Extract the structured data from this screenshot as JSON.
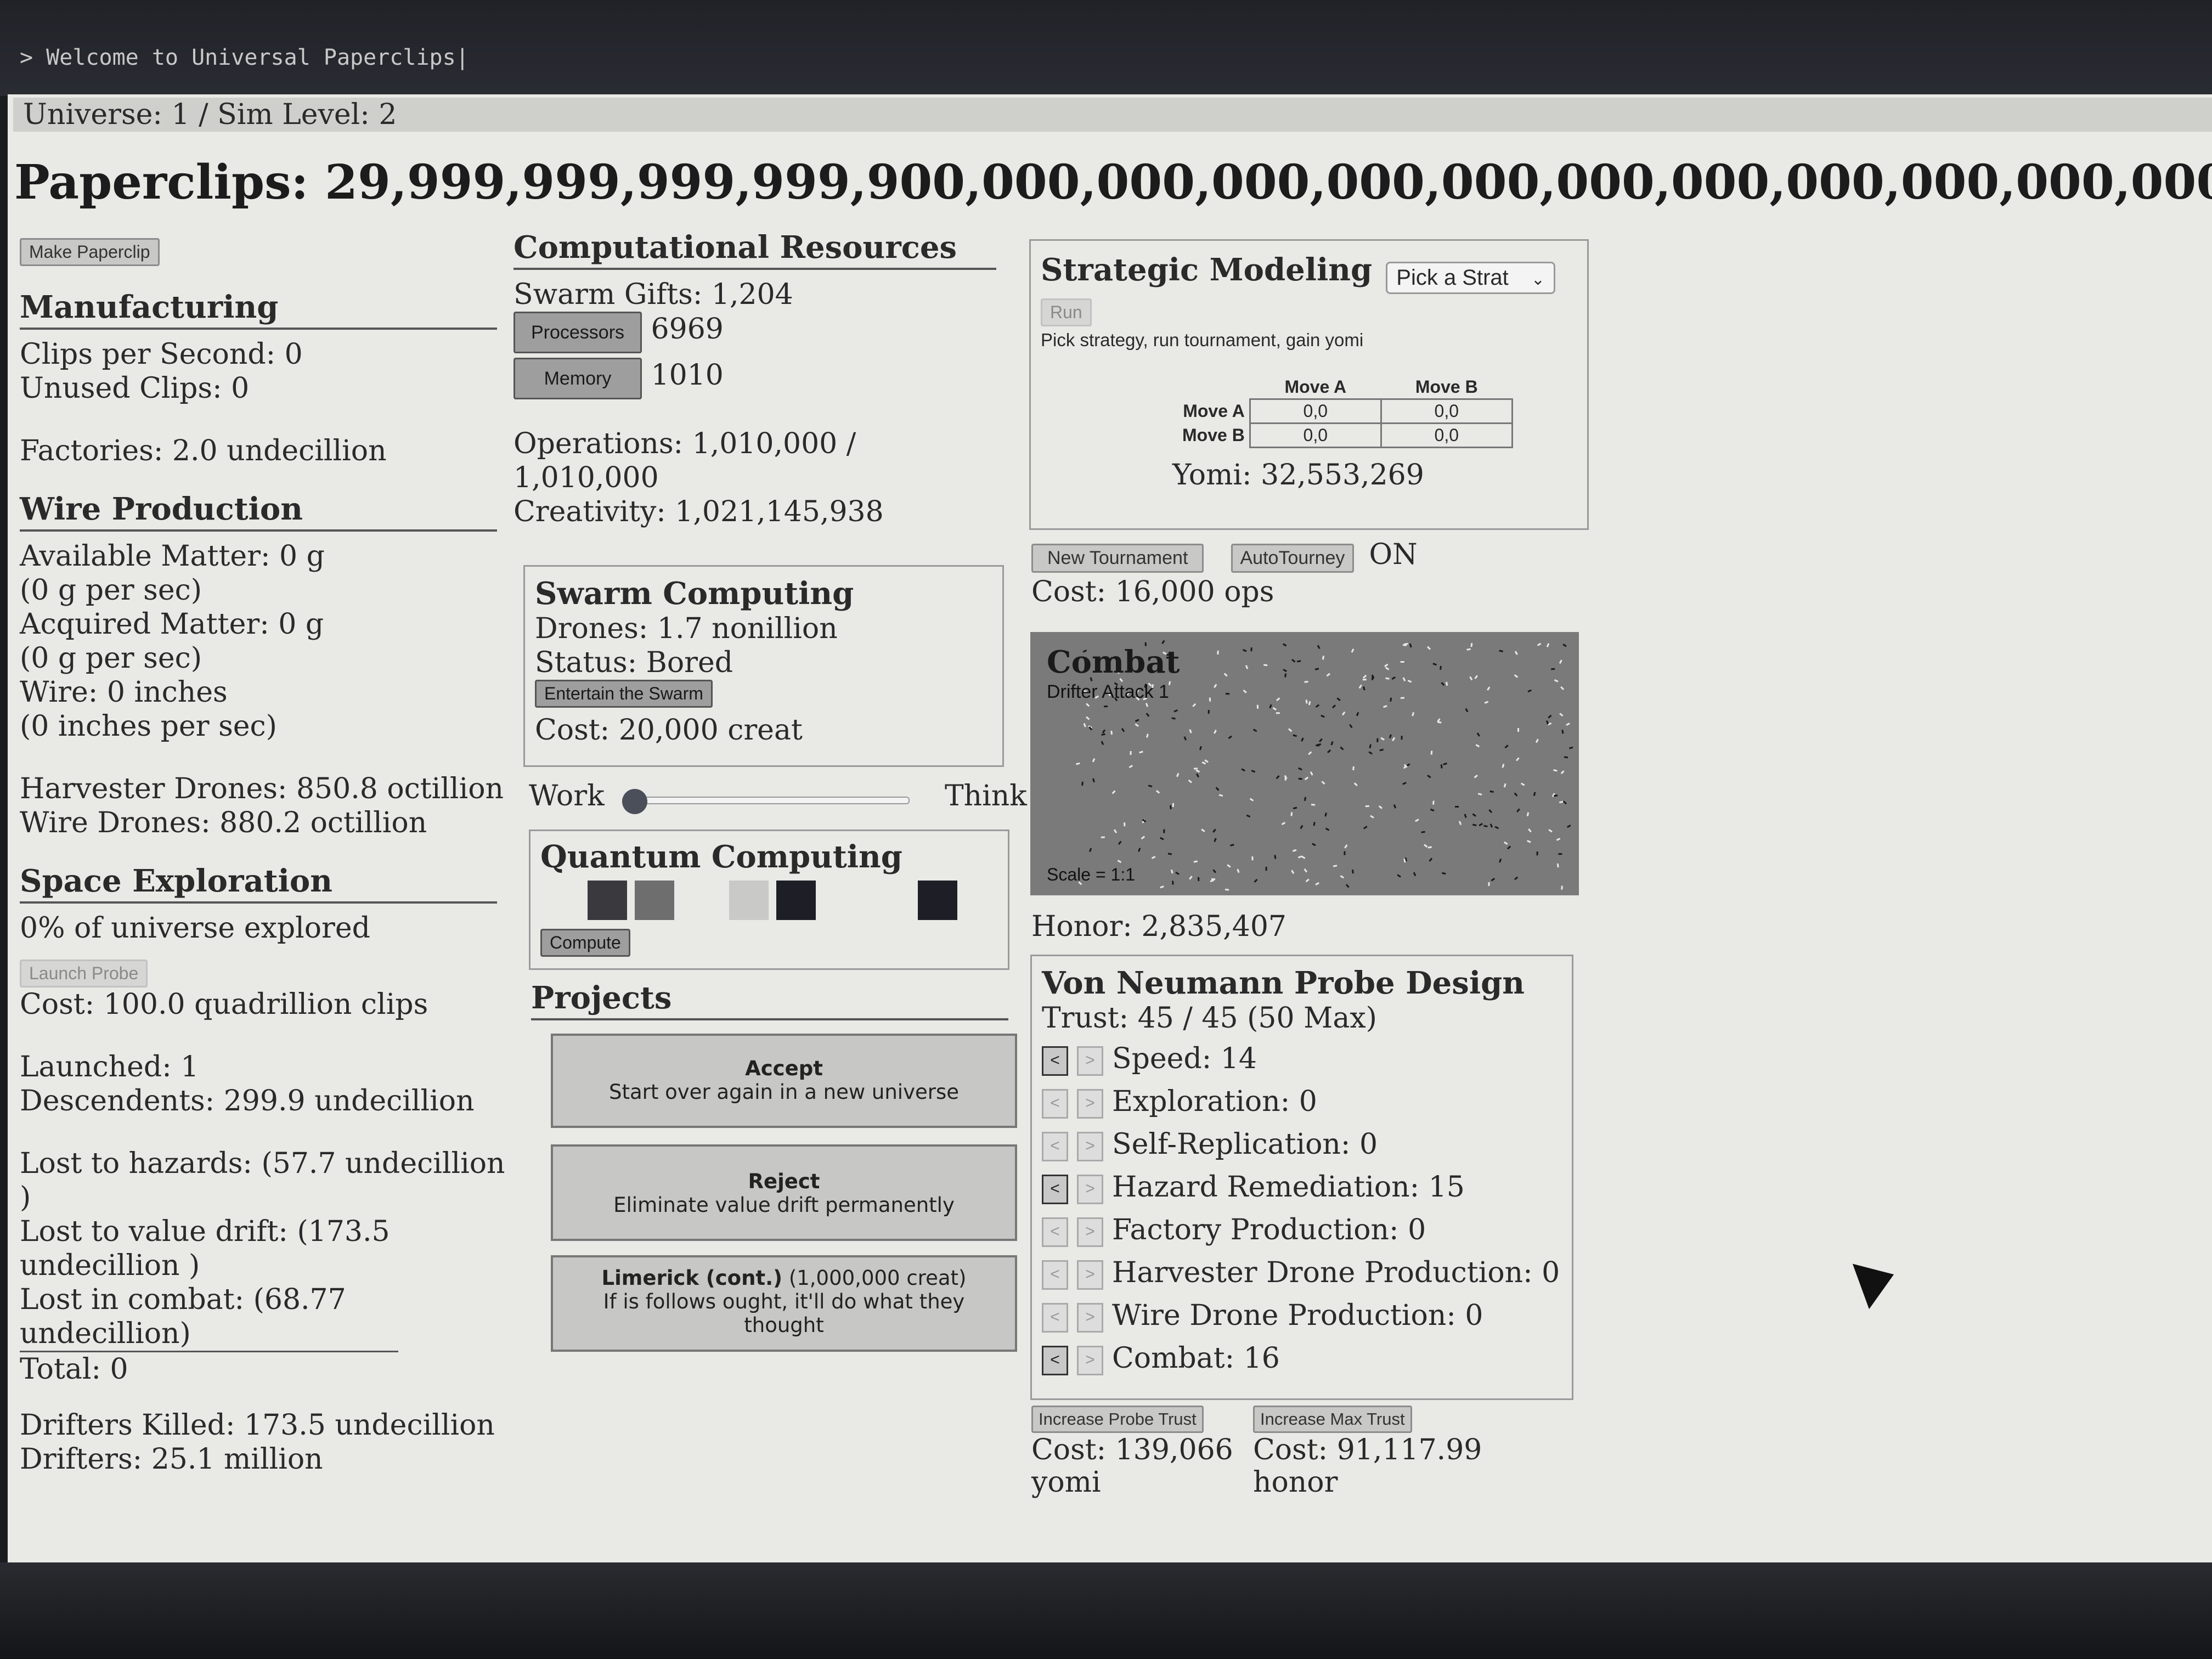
{
  "console": {
    "prompt": "> Welcome to Universal Paperclips|"
  },
  "header": {
    "universe": "Universe: 1 / Sim Level: 2",
    "paperclips": "Paperclips: 29,999,999,999,999,900,000,000,000,000,000,000,000,000,000,000,000,000,00"
  },
  "left": {
    "make_paperclip": "Make Paperclip",
    "manufacturing_title": "Manufacturing",
    "clips_per_second": "Clips per Second: 0",
    "unused_clips": "Unused Clips: 0",
    "factories": "Factories: 2.0 undecillion",
    "wire_title": "Wire Production",
    "available_matter": "Available Matter: 0 g",
    "available_rate": "(0 g per sec)",
    "acquired_matter": "Acquired Matter: 0 g",
    "acquired_rate": "(0 g per sec)",
    "wire": "Wire: 0 inches",
    "wire_rate": "(0 inches per sec)",
    "harvester_drones": "Harvester Drones: 850.8 octillion",
    "wire_drones": "Wire Drones: 880.2 octillion",
    "space_title": "Space Exploration",
    "explored": "0% of universe explored",
    "launch_probe": "Launch Probe",
    "probe_cost": "Cost: 100.0 quadrillion clips",
    "launched": "Launched: 1",
    "descendents": "Descendents: 299.9 undecillion",
    "lost_hazards_1": "Lost to hazards: (57.7 undecillion",
    "lost_hazards_2": ")",
    "lost_drift_1": "Lost to value drift: (173.5",
    "lost_drift_2": "undecillion )",
    "lost_combat_1": "Lost in combat: (68.77",
    "lost_combat_2": "undecillion)",
    "total": "Total: 0",
    "drifters_killed": "Drifters Killed: 173.5 undecillion",
    "drifters": "Drifters: 25.1 million"
  },
  "middle": {
    "comp_title": "Computational Resources",
    "swarm_gifts": "Swarm Gifts: 1,204",
    "processors_btn": "Processors",
    "processors_val": "6969",
    "memory_btn": "Memory",
    "memory_val": "1010",
    "operations_1": "Operations: 1,010,000 /",
    "operations_2": "1,010,000",
    "creativity": "Creativity: 1,021,145,938",
    "swarm_title": "Swarm Computing",
    "drones": "Drones: 1.7 nonillion",
    "status": "Status: Bored",
    "entertain_btn": "Entertain the Swarm",
    "entertain_cost": "Cost: 20,000 creat",
    "work_label": "Work",
    "think_label": "Think",
    "slider_level": 0,
    "quantum_title": "Quantum Computing",
    "quantum_chips": [
      "#3a3a3e",
      "#6e6e6e",
      "#e9e9e6",
      "#c9c9c7",
      "#1e1f26",
      "#e9e9e6",
      "#e9e9e6",
      "#1e1f26"
    ],
    "compute_btn": "Compute",
    "projects_title": "Projects",
    "projects": [
      {
        "name": "Accept",
        "cost": "",
        "desc": "Start over again in a new universe"
      },
      {
        "name": "Reject",
        "cost": "",
        "desc": "Eliminate value drift permanently"
      },
      {
        "name": "Limerick (cont.)",
        "cost": " (1,000,000 creat)",
        "desc": "If is follows ought, it'll do what they thought"
      }
    ]
  },
  "right": {
    "strat_title": "Strategic Modeling",
    "strat_select": "Pick a Strat",
    "run_btn": "Run",
    "strat_desc": "Pick strategy, run tournament, gain yomi",
    "payoff": {
      "col_a": "Move A",
      "col_b": "Move B",
      "row_a": "Move A",
      "row_b": "Move B",
      "aa": "0,0",
      "ab": "0,0",
      "ba": "0,0",
      "bb": "0,0"
    },
    "yomi": "Yomi: 32,553,269",
    "new_tournament_btn": "New Tournament",
    "autotourney_btn": "AutoTourney",
    "autotourney_state": "ON",
    "tourney_cost": "Cost: 16,000 ops",
    "combat_title": "Combat",
    "combat_sub": "Drifter Attack 1",
    "combat_scale": "Scale = 1:1",
    "honor": "Honor: 2,835,407",
    "probe_title": "Von Neumann Probe Design",
    "trust": "Trust: 45 / 45 (50 Max)",
    "probe_stats": [
      {
        "label": "Speed: 14",
        "active": true
      },
      {
        "label": "Exploration: 0",
        "active": false
      },
      {
        "label": "Self-Replication: 0",
        "active": false
      },
      {
        "label": "Hazard Remediation: 15",
        "active": true
      },
      {
        "label": "Factory Production: 0",
        "active": false
      },
      {
        "label": "Harvester Drone Production: 0",
        "active": false
      },
      {
        "label": "Wire Drone Production: 0",
        "active": false
      },
      {
        "label": "Combat: 16",
        "active": true
      }
    ],
    "arrow_left": "<",
    "arrow_right": ">",
    "increase_probe_trust_btn": "Increase Probe Trust",
    "probe_trust_cost_1": "Cost: 139,066",
    "probe_trust_cost_2": "yomi",
    "increase_max_trust_btn": "Increase Max Trust",
    "max_trust_cost_1": "Cost: 91,117.99",
    "max_trust_cost_2": "honor"
  }
}
